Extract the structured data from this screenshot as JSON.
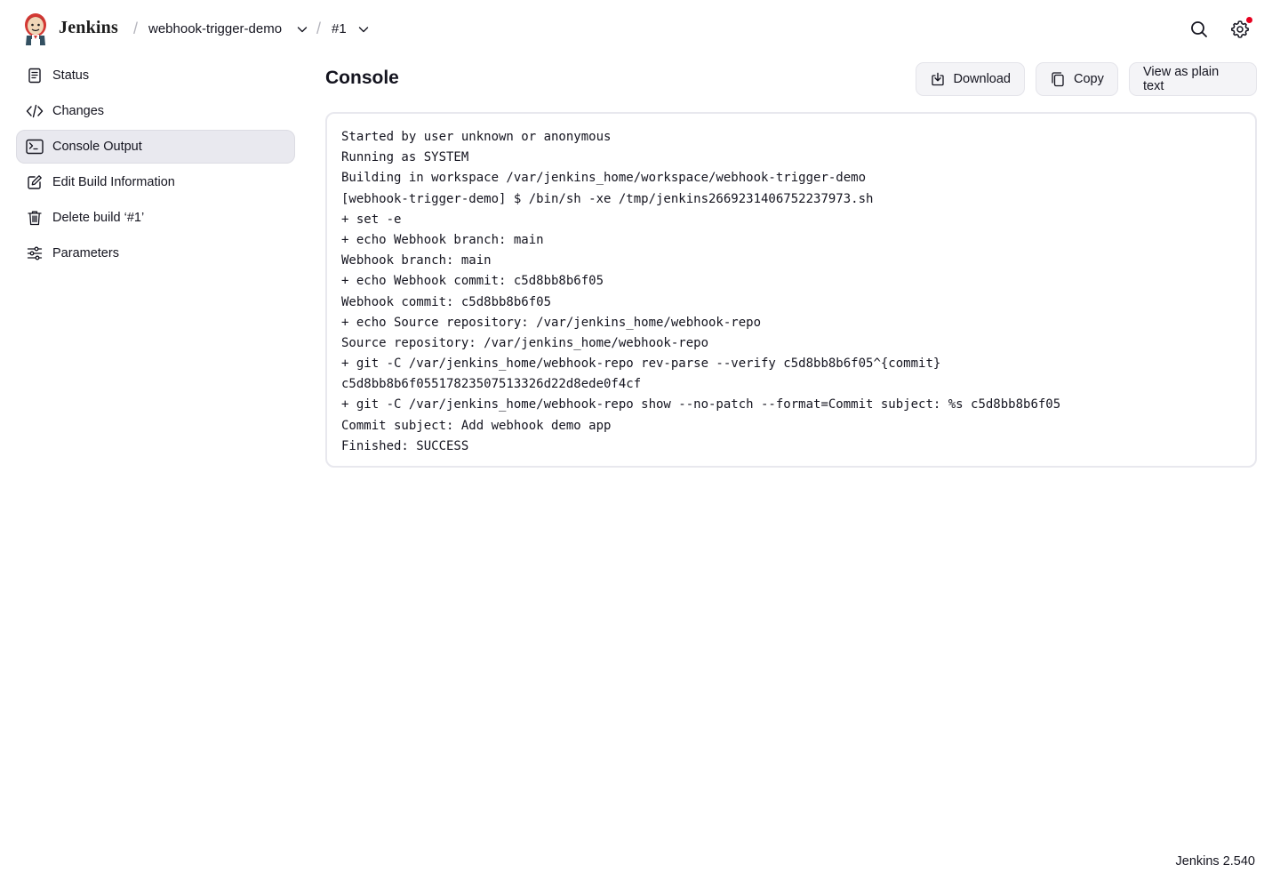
{
  "header": {
    "brand": "Jenkins",
    "crumbs": [
      {
        "label": "webhook-trigger-demo"
      },
      {
        "label": "#1"
      }
    ],
    "separator": "/"
  },
  "sidebar": {
    "items": [
      {
        "label": "Status",
        "icon": "document-icon"
      },
      {
        "label": "Changes",
        "icon": "code-icon"
      },
      {
        "label": "Console Output",
        "icon": "terminal-icon",
        "active": true
      },
      {
        "label": "Edit Build Information",
        "icon": "edit-icon"
      },
      {
        "label": "Delete build ‘#1’",
        "icon": "trash-icon"
      },
      {
        "label": "Parameters",
        "icon": "sliders-icon"
      }
    ]
  },
  "main": {
    "title": "Console",
    "buttons": {
      "download": "Download",
      "copy": "Copy",
      "plain_text": "View as plain text"
    },
    "console_lines": [
      "Started by user unknown or anonymous",
      "Running as SYSTEM",
      "Building in workspace /var/jenkins_home/workspace/webhook-trigger-demo",
      "[webhook-trigger-demo] $ /bin/sh -xe /tmp/jenkins2669231406752237973.sh",
      "+ set -e",
      "+ echo Webhook branch: main",
      "Webhook branch: main",
      "+ echo Webhook commit: c5d8bb8b6f05",
      "Webhook commit: c5d8bb8b6f05",
      "+ echo Source repository: /var/jenkins_home/webhook-repo",
      "Source repository: /var/jenkins_home/webhook-repo",
      "+ git -C /var/jenkins_home/webhook-repo rev-parse --verify c5d8bb8b6f05^{commit}",
      "c5d8bb8b6f05517823507513326d22d8ede0f4cf",
      "+ git -C /var/jenkins_home/webhook-repo show --no-patch --format=Commit subject: %s c5d8bb8b6f05",
      "Commit subject: Add webhook demo app",
      "Finished: SUCCESS"
    ]
  },
  "footer": {
    "version": "Jenkins 2.540"
  },
  "colors": {
    "active_bg": "#e9e9ef",
    "notification": "#e6001f",
    "button_bg": "#f4f4f7"
  }
}
